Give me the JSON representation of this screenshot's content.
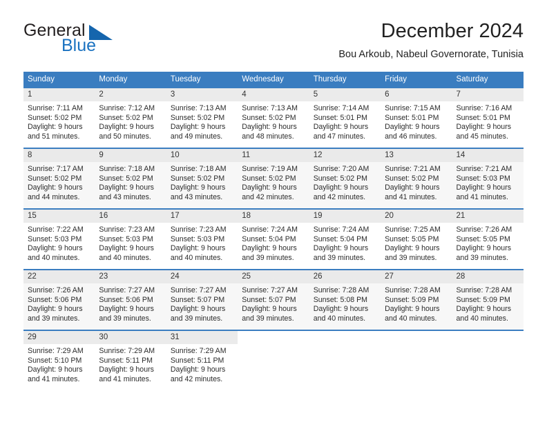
{
  "brand": {
    "name_part1": "General",
    "name_part2": "Blue",
    "accent_color": "#1565ad",
    "logo_icon": "triangle-logo-icon"
  },
  "header": {
    "title": "December 2024",
    "subtitle": "Bou Arkoub, Nabeul Governorate, Tunisia"
  },
  "calendar": {
    "header_bg": "#3a7dc0",
    "weekdays": [
      "Sunday",
      "Monday",
      "Tuesday",
      "Wednesday",
      "Thursday",
      "Friday",
      "Saturday"
    ],
    "weeks": [
      [
        {
          "day": "1",
          "sunrise": "Sunrise: 7:11 AM",
          "sunset": "Sunset: 5:02 PM",
          "daylight_line1": "Daylight: 9 hours",
          "daylight_line2": "and 51 minutes."
        },
        {
          "day": "2",
          "sunrise": "Sunrise: 7:12 AM",
          "sunset": "Sunset: 5:02 PM",
          "daylight_line1": "Daylight: 9 hours",
          "daylight_line2": "and 50 minutes."
        },
        {
          "day": "3",
          "sunrise": "Sunrise: 7:13 AM",
          "sunset": "Sunset: 5:02 PM",
          "daylight_line1": "Daylight: 9 hours",
          "daylight_line2": "and 49 minutes."
        },
        {
          "day": "4",
          "sunrise": "Sunrise: 7:13 AM",
          "sunset": "Sunset: 5:02 PM",
          "daylight_line1": "Daylight: 9 hours",
          "daylight_line2": "and 48 minutes."
        },
        {
          "day": "5",
          "sunrise": "Sunrise: 7:14 AM",
          "sunset": "Sunset: 5:01 PM",
          "daylight_line1": "Daylight: 9 hours",
          "daylight_line2": "and 47 minutes."
        },
        {
          "day": "6",
          "sunrise": "Sunrise: 7:15 AM",
          "sunset": "Sunset: 5:01 PM",
          "daylight_line1": "Daylight: 9 hours",
          "daylight_line2": "and 46 minutes."
        },
        {
          "day": "7",
          "sunrise": "Sunrise: 7:16 AM",
          "sunset": "Sunset: 5:01 PM",
          "daylight_line1": "Daylight: 9 hours",
          "daylight_line2": "and 45 minutes."
        }
      ],
      [
        {
          "day": "8",
          "sunrise": "Sunrise: 7:17 AM",
          "sunset": "Sunset: 5:02 PM",
          "daylight_line1": "Daylight: 9 hours",
          "daylight_line2": "and 44 minutes."
        },
        {
          "day": "9",
          "sunrise": "Sunrise: 7:18 AM",
          "sunset": "Sunset: 5:02 PM",
          "daylight_line1": "Daylight: 9 hours",
          "daylight_line2": "and 43 minutes."
        },
        {
          "day": "10",
          "sunrise": "Sunrise: 7:18 AM",
          "sunset": "Sunset: 5:02 PM",
          "daylight_line1": "Daylight: 9 hours",
          "daylight_line2": "and 43 minutes."
        },
        {
          "day": "11",
          "sunrise": "Sunrise: 7:19 AM",
          "sunset": "Sunset: 5:02 PM",
          "daylight_line1": "Daylight: 9 hours",
          "daylight_line2": "and 42 minutes."
        },
        {
          "day": "12",
          "sunrise": "Sunrise: 7:20 AM",
          "sunset": "Sunset: 5:02 PM",
          "daylight_line1": "Daylight: 9 hours",
          "daylight_line2": "and 42 minutes."
        },
        {
          "day": "13",
          "sunrise": "Sunrise: 7:21 AM",
          "sunset": "Sunset: 5:02 PM",
          "daylight_line1": "Daylight: 9 hours",
          "daylight_line2": "and 41 minutes."
        },
        {
          "day": "14",
          "sunrise": "Sunrise: 7:21 AM",
          "sunset": "Sunset: 5:03 PM",
          "daylight_line1": "Daylight: 9 hours",
          "daylight_line2": "and 41 minutes."
        }
      ],
      [
        {
          "day": "15",
          "sunrise": "Sunrise: 7:22 AM",
          "sunset": "Sunset: 5:03 PM",
          "daylight_line1": "Daylight: 9 hours",
          "daylight_line2": "and 40 minutes."
        },
        {
          "day": "16",
          "sunrise": "Sunrise: 7:23 AM",
          "sunset": "Sunset: 5:03 PM",
          "daylight_line1": "Daylight: 9 hours",
          "daylight_line2": "and 40 minutes."
        },
        {
          "day": "17",
          "sunrise": "Sunrise: 7:23 AM",
          "sunset": "Sunset: 5:03 PM",
          "daylight_line1": "Daylight: 9 hours",
          "daylight_line2": "and 40 minutes."
        },
        {
          "day": "18",
          "sunrise": "Sunrise: 7:24 AM",
          "sunset": "Sunset: 5:04 PM",
          "daylight_line1": "Daylight: 9 hours",
          "daylight_line2": "and 39 minutes."
        },
        {
          "day": "19",
          "sunrise": "Sunrise: 7:24 AM",
          "sunset": "Sunset: 5:04 PM",
          "daylight_line1": "Daylight: 9 hours",
          "daylight_line2": "and 39 minutes."
        },
        {
          "day": "20",
          "sunrise": "Sunrise: 7:25 AM",
          "sunset": "Sunset: 5:05 PM",
          "daylight_line1": "Daylight: 9 hours",
          "daylight_line2": "and 39 minutes."
        },
        {
          "day": "21",
          "sunrise": "Sunrise: 7:26 AM",
          "sunset": "Sunset: 5:05 PM",
          "daylight_line1": "Daylight: 9 hours",
          "daylight_line2": "and 39 minutes."
        }
      ],
      [
        {
          "day": "22",
          "sunrise": "Sunrise: 7:26 AM",
          "sunset": "Sunset: 5:06 PM",
          "daylight_line1": "Daylight: 9 hours",
          "daylight_line2": "and 39 minutes."
        },
        {
          "day": "23",
          "sunrise": "Sunrise: 7:27 AM",
          "sunset": "Sunset: 5:06 PM",
          "daylight_line1": "Daylight: 9 hours",
          "daylight_line2": "and 39 minutes."
        },
        {
          "day": "24",
          "sunrise": "Sunrise: 7:27 AM",
          "sunset": "Sunset: 5:07 PM",
          "daylight_line1": "Daylight: 9 hours",
          "daylight_line2": "and 39 minutes."
        },
        {
          "day": "25",
          "sunrise": "Sunrise: 7:27 AM",
          "sunset": "Sunset: 5:07 PM",
          "daylight_line1": "Daylight: 9 hours",
          "daylight_line2": "and 39 minutes."
        },
        {
          "day": "26",
          "sunrise": "Sunrise: 7:28 AM",
          "sunset": "Sunset: 5:08 PM",
          "daylight_line1": "Daylight: 9 hours",
          "daylight_line2": "and 40 minutes."
        },
        {
          "day": "27",
          "sunrise": "Sunrise: 7:28 AM",
          "sunset": "Sunset: 5:09 PM",
          "daylight_line1": "Daylight: 9 hours",
          "daylight_line2": "and 40 minutes."
        },
        {
          "day": "28",
          "sunrise": "Sunrise: 7:28 AM",
          "sunset": "Sunset: 5:09 PM",
          "daylight_line1": "Daylight: 9 hours",
          "daylight_line2": "and 40 minutes."
        }
      ],
      [
        {
          "day": "29",
          "sunrise": "Sunrise: 7:29 AM",
          "sunset": "Sunset: 5:10 PM",
          "daylight_line1": "Daylight: 9 hours",
          "daylight_line2": "and 41 minutes."
        },
        {
          "day": "30",
          "sunrise": "Sunrise: 7:29 AM",
          "sunset": "Sunset: 5:11 PM",
          "daylight_line1": "Daylight: 9 hours",
          "daylight_line2": "and 41 minutes."
        },
        {
          "day": "31",
          "sunrise": "Sunrise: 7:29 AM",
          "sunset": "Sunset: 5:11 PM",
          "daylight_line1": "Daylight: 9 hours",
          "daylight_line2": "and 42 minutes."
        },
        {
          "day": "",
          "sunrise": "",
          "sunset": "",
          "daylight_line1": "",
          "daylight_line2": ""
        },
        {
          "day": "",
          "sunrise": "",
          "sunset": "",
          "daylight_line1": "",
          "daylight_line2": ""
        },
        {
          "day": "",
          "sunrise": "",
          "sunset": "",
          "daylight_line1": "",
          "daylight_line2": ""
        },
        {
          "day": "",
          "sunrise": "",
          "sunset": "",
          "daylight_line1": "",
          "daylight_line2": ""
        }
      ]
    ]
  }
}
